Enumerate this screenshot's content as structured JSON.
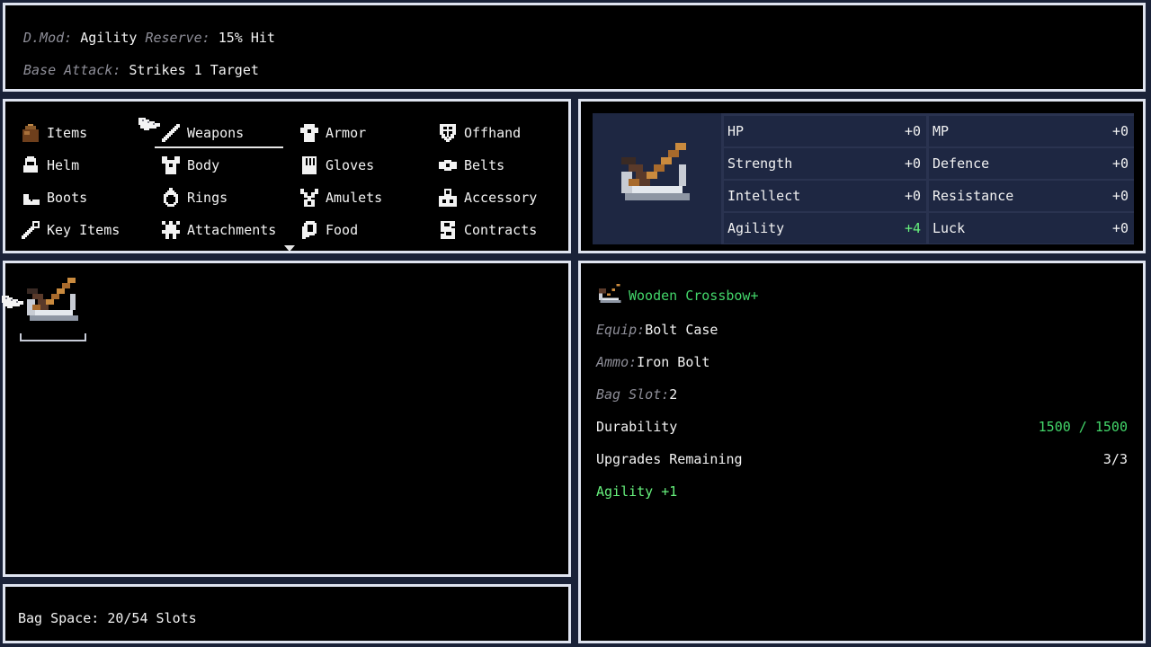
{
  "top": {
    "dmod_label": "D.Mod:",
    "dmod_value": "Agility",
    "reserve_label": "Reserve:",
    "reserve_value": "15% Hit",
    "base_label": "Base Attack:",
    "base_value": "Strikes 1 Target"
  },
  "categories": [
    {
      "label": "Items",
      "icon": "bag-icon"
    },
    {
      "label": "Weapons",
      "icon": "sword-icon",
      "selected": true
    },
    {
      "label": "Armor",
      "icon": "armor-icon"
    },
    {
      "label": "Offhand",
      "icon": "shield-icon"
    },
    {
      "label": "Helm",
      "icon": "helm-icon"
    },
    {
      "label": "Body",
      "icon": "body-icon"
    },
    {
      "label": "Gloves",
      "icon": "gloves-icon"
    },
    {
      "label": "Belts",
      "icon": "belt-icon"
    },
    {
      "label": "Boots",
      "icon": "boots-icon"
    },
    {
      "label": "Rings",
      "icon": "ring-icon"
    },
    {
      "label": "Amulets",
      "icon": "amulet-icon"
    },
    {
      "label": "Accessory",
      "icon": "accessory-icon"
    },
    {
      "label": "Key Items",
      "icon": "key-icon"
    },
    {
      "label": "Attachments",
      "icon": "attachment-icon"
    },
    {
      "label": "Food",
      "icon": "food-icon"
    },
    {
      "label": "Contracts",
      "icon": "contract-icon"
    }
  ],
  "stats": [
    {
      "name": "HP",
      "value": "+0"
    },
    {
      "name": "MP",
      "value": "+0"
    },
    {
      "name": "Strength",
      "value": "+0"
    },
    {
      "name": "Defence",
      "value": "+0"
    },
    {
      "name": "Intellect",
      "value": "+0"
    },
    {
      "name": "Resistance",
      "value": "+0"
    },
    {
      "name": "Agility",
      "value": "+4",
      "highlight": true
    },
    {
      "name": "Luck",
      "value": "+0"
    }
  ],
  "bag": {
    "text": "Bag Space: 20/54 Slots"
  },
  "detail": {
    "name": "Wooden Crossbow+",
    "equip_label": "Equip:",
    "equip_value": "Bolt Case",
    "ammo_label": "Ammo:",
    "ammo_value": "Iron Bolt",
    "bagslot_label": "Bag Slot:",
    "bagslot_value": "2",
    "durability_label": "Durability",
    "durability_value": "1500 / 1500",
    "upgrades_label": "Upgrades Remaining",
    "upgrades_value": "3/3",
    "bonus": "Agility +1"
  },
  "colors": {
    "panel_border": "#dfe4f0",
    "background": "#1a2238",
    "stat_cell": "#1e2742",
    "accent_green": "#43d66a"
  },
  "icons": {
    "weapon": "crossbow-icon",
    "cursor": "pointing-hand-icon"
  }
}
